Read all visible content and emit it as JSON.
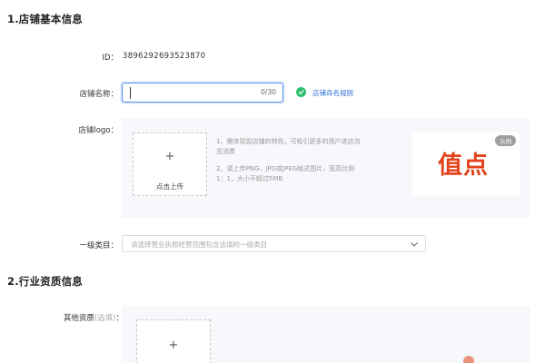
{
  "section1": {
    "title": "1.店铺基本信息"
  },
  "id_row": {
    "label": "ID：",
    "value": "3896292693523870"
  },
  "store_name": {
    "label": "店铺名称：",
    "value": "",
    "counter": "0/30",
    "rule_link": "店铺命名规则",
    "check_color": "#2fbf71"
  },
  "logo": {
    "label": "店铺logo：",
    "upload_plus": "+",
    "upload_label": "点击上传",
    "hint1_line1": "1、需体现您店铺的特色，可吸引更多的用户进店浏",
    "hint1_line2": "览消费",
    "hint2_line1": "2、请上传PNG、JPG或JPEG格式图片，宽高比例",
    "hint2_line2": "1：1，大小不超过5MB",
    "sample_badge": "示例",
    "sample_logo_text": "值点",
    "sample_logo_color": "#e2431c"
  },
  "category": {
    "label": "一级类目：",
    "placeholder": "请选择营业执照经营范围包含选填的一级类目",
    "icon": "chevron-down-icon"
  },
  "section2": {
    "title": "2.行业资质信息"
  },
  "other_qual": {
    "label_main": "其他资质",
    "label_optional": "(选填)",
    "label_colon": "：",
    "upload_plus": "+"
  }
}
